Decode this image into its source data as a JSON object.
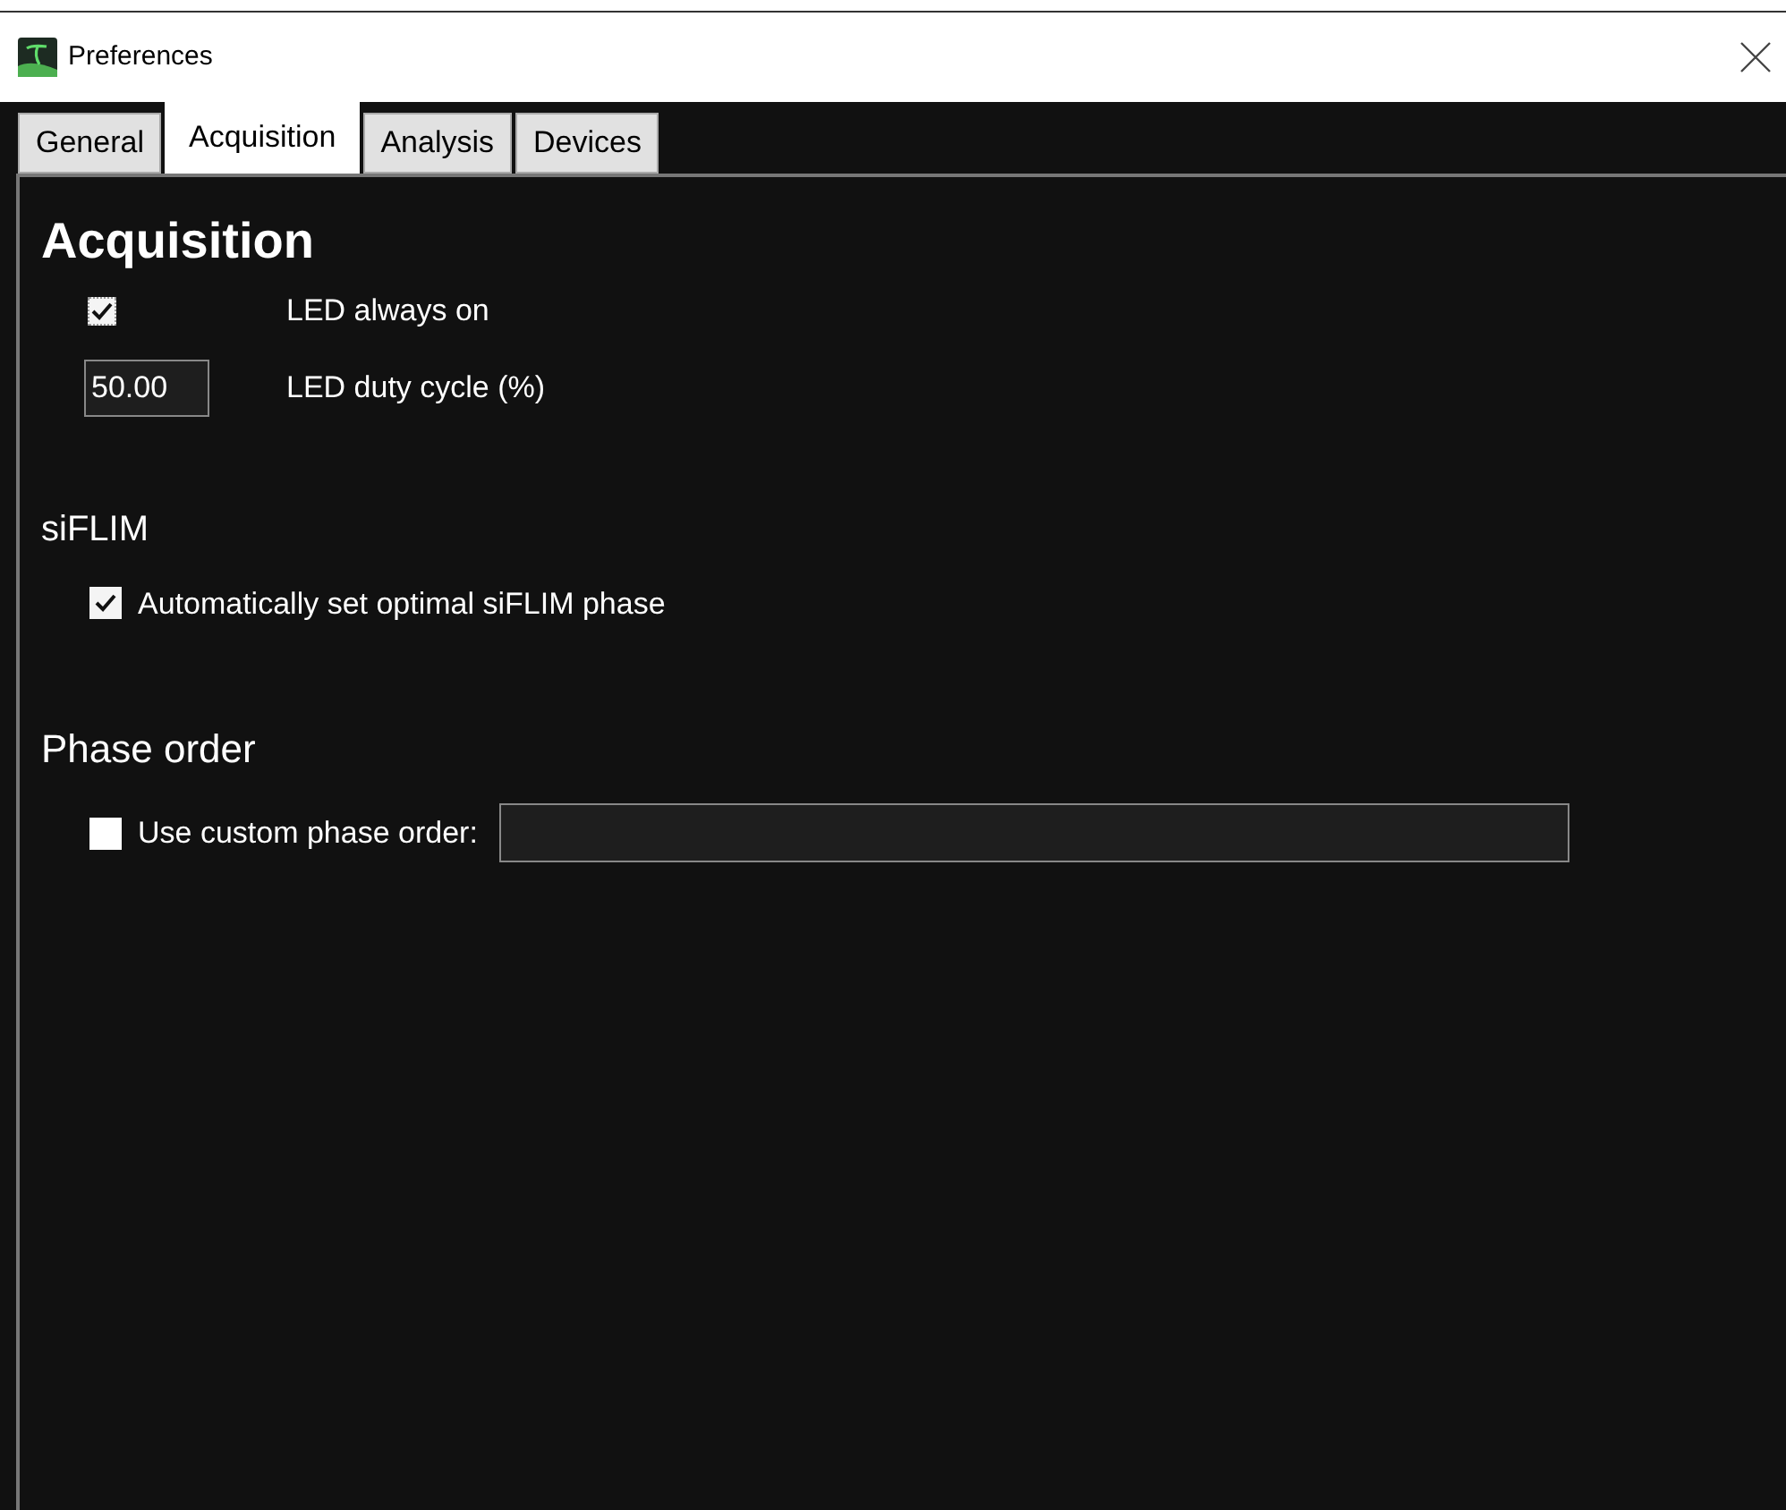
{
  "window": {
    "title": "Preferences"
  },
  "tabs": [
    {
      "label": "General",
      "selected": false
    },
    {
      "label": "Acquisition",
      "selected": true
    },
    {
      "label": "Analysis",
      "selected": false
    },
    {
      "label": "Devices",
      "selected": false
    }
  ],
  "heading": "Acquisition",
  "settings": [
    {
      "kind": "checkbox",
      "label": "LED always on",
      "checked": true
    },
    {
      "kind": "number",
      "label": "LED duty cycle (%)",
      "value": "50.00"
    }
  ],
  "siflim": {
    "title": "siFLIM",
    "options": [
      {
        "label": "Automatically set optimal siFLIM phase",
        "checked": true
      }
    ]
  },
  "phase_order": {
    "title": "Phase order",
    "checkbox": {
      "label": "Use custom phase order:",
      "checked": false
    }
  }
}
